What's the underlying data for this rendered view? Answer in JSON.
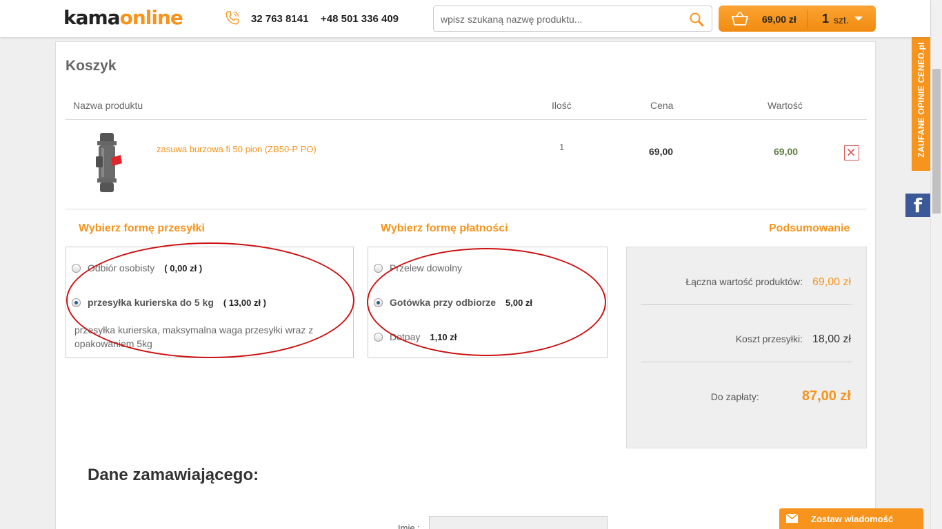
{
  "header": {
    "logo_part1": "kama",
    "logo_part2": "online",
    "phone_icon": "phone-icon",
    "phone1": "32 763 8141",
    "phone2": "+48 501 336 409",
    "search_placeholder": "wpisz szukaną nazwę produktu...",
    "search_icon": "magnifier-icon",
    "cart_icon": "basket-icon",
    "cart_total": "69,00 zł",
    "cart_count": "1",
    "cart_unit": "szt."
  },
  "cart": {
    "title": "Koszyk",
    "columns": [
      "Nazwa produktu",
      "Ilość",
      "Cena",
      "Wartość"
    ],
    "items": [
      {
        "name": "zasuwa burzowa fi 50 pion (ZB50-P PO)",
        "qty": "1",
        "price": "69,00",
        "value": "69,00"
      }
    ],
    "remove_icon": "close-icon"
  },
  "shipping": {
    "title": "Wybierz formę przesyłki",
    "options": [
      {
        "label": "Odbiór osobisty",
        "price": "( 0,00 zł )",
        "selected": false
      },
      {
        "label": "przesyłka kurierska do 5 kg",
        "price": "( 13,00 zł )",
        "selected": true
      }
    ],
    "description": "przesyłka kurierska, maksymalna waga przesyłki wraz z opakowaniem 5kg"
  },
  "payment": {
    "title": "Wybierz formę płatności",
    "options": [
      {
        "label": "Przelew dowolny",
        "price": "",
        "selected": false
      },
      {
        "label": "Gotówka przy odbiorze",
        "price": "5,00 zł",
        "selected": true
      },
      {
        "label": "Dotpay",
        "price": "1,10 zł",
        "selected": false
      }
    ]
  },
  "summary": {
    "title": "Podsumowanie",
    "products_label": "Łączna wartość produktów:",
    "products_value": "69,00 zł",
    "shipping_label": "Koszt przesyłki:",
    "shipping_value": "18,00 zł",
    "total_label": "Do zapłaty:",
    "total_value": "87,00 zł"
  },
  "customer": {
    "title": "Dane zamawiającego:",
    "name_label": "Imię :"
  },
  "side": {
    "ceneo_label": "ZAUFANE OPINIE CENEO.pl",
    "fb_label": "f"
  },
  "message": {
    "icon": "envelope-icon",
    "label": "Zostaw wiadomość"
  },
  "colors": {
    "accent": "#f7941d",
    "value_green": "#5f7d3f",
    "annotation_red": "#cc1111",
    "facebook": "#3b5998"
  }
}
